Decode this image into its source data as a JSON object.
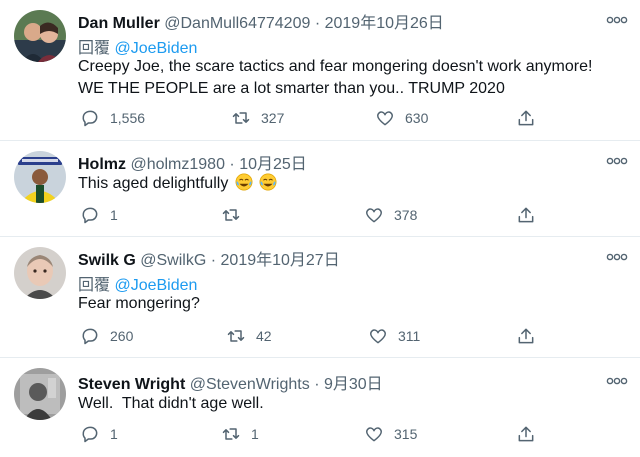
{
  "tweets": [
    {
      "name": "Dan Muller",
      "handle": "@DanMull64774209",
      "separator": "·",
      "date": "2019年10月26日",
      "reply_prefix": "回覆",
      "reply_to": "@JoeBiden",
      "text_lines": [
        "Creepy Joe, the scare tactics and fear mongering doesn't work anymore!",
        "WE THE PEOPLE are a lot smarter than you.. TRUMP 2020"
      ],
      "replies": "1,556",
      "retweets": "327",
      "likes": "630",
      "avatar_icon": "dan-muller-avatar"
    },
    {
      "name": "Holmz",
      "handle": "@holmz1980",
      "separator": "·",
      "date": "10月25日",
      "text_lines": [
        "This aged delightfully"
      ],
      "emoji": [
        "face-with-tears-of-joy",
        "face-with-tears-of-joy"
      ],
      "replies": "1",
      "retweets": "",
      "likes": "378",
      "avatar_icon": "holmz-avatar"
    },
    {
      "name": "Swilk G",
      "handle": "@SwilkG",
      "separator": "·",
      "date": "2019年10月27日",
      "reply_prefix": "回覆",
      "reply_to": "@JoeBiden",
      "text_lines": [
        "Fear mongering?"
      ],
      "replies": "260",
      "retweets": "42",
      "likes": "311",
      "avatar_icon": "swilk-g-avatar"
    },
    {
      "name": "Steven Wright",
      "handle": "@StevenWrights",
      "separator": "·",
      "date": "9月30日",
      "text_lines": [
        "Well.  That didn't age well."
      ],
      "replies": "1",
      "retweets": "1",
      "likes": "315",
      "avatar_icon": "steven-wright-avatar"
    }
  ],
  "colors": {
    "text": "#0f1419",
    "secondary": "#536471",
    "link": "#1d9bf0",
    "divider": "#e6ecf0"
  },
  "icons": [
    "reply-icon",
    "retweet-icon",
    "like-icon",
    "share-icon",
    "more-icon"
  ]
}
